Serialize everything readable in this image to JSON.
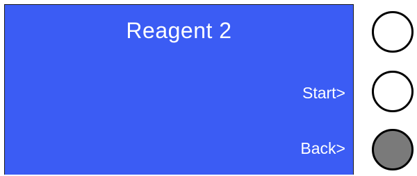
{
  "display": {
    "title": "Reagent 2",
    "softkeys": {
      "start_label": "Start>",
      "back_label": "Back>"
    }
  },
  "colors": {
    "screen_background": "#3b5cf4",
    "screen_text": "#ffffff",
    "button_idle": "#ffffff",
    "button_active": "#7a7a7a",
    "button_outline": "#000000"
  },
  "hardware_buttons": [
    {
      "name": "top",
      "state": "idle"
    },
    {
      "name": "start",
      "state": "idle"
    },
    {
      "name": "back",
      "state": "pressed"
    }
  ]
}
